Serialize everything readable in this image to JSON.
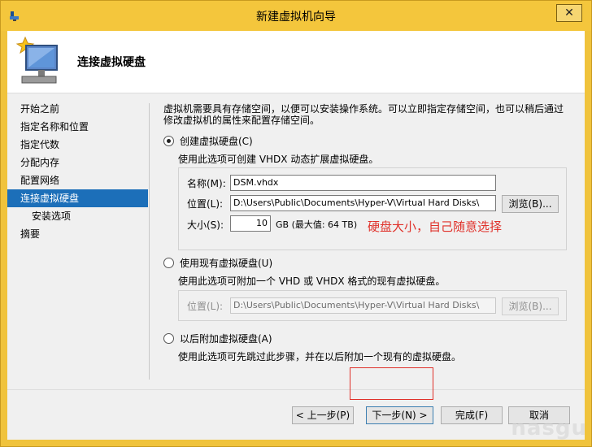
{
  "window": {
    "title": "新建虚拟机向导",
    "close_glyph": "✕"
  },
  "header": {
    "title": "连接虚拟硬盘"
  },
  "nav": {
    "items": [
      {
        "label": "开始之前"
      },
      {
        "label": "指定名称和位置"
      },
      {
        "label": "指定代数"
      },
      {
        "label": "分配内存"
      },
      {
        "label": "配置网络"
      },
      {
        "label": "连接虚拟硬盘"
      },
      {
        "label": "安装选项"
      },
      {
        "label": "摘要"
      }
    ]
  },
  "content": {
    "intro": "虚拟机需要具有存储空间，以便可以安装操作系统。可以立即指定存储空间，也可以稍后通过修改虚拟机的属性来配置存储空间。",
    "create": {
      "label": "创建虚拟硬盘(C)",
      "desc": "使用此选项可创建 VHDX 动态扩展虚拟硬盘。",
      "name_label": "名称(M):",
      "name_value": "DSM.vhdx",
      "location_label": "位置(L):",
      "location_value": "D:\\Users\\Public\\Documents\\Hyper-V\\Virtual Hard Disks\\",
      "browse_label": "浏览(B)...",
      "size_label": "大小(S):",
      "size_value": "10",
      "size_unit": "GB (最大值: 64 TB)",
      "annotation": "硬盘大小，自己随意选择"
    },
    "existing": {
      "label": "使用现有虚拟硬盘(U)",
      "desc": "使用此选项可附加一个 VHD 或 VHDX 格式的现有虚拟硬盘。",
      "location_label": "位置(L):",
      "location_value": "D:\\Users\\Public\\Documents\\Hyper-V\\Virtual Hard Disks\\",
      "browse_label": "浏览(B)..."
    },
    "later": {
      "label": "以后附加虚拟硬盘(A)",
      "desc": "使用此选项可先跳过此步骤，并在以后附加一个现有的虚拟硬盘。"
    }
  },
  "footer": {
    "prev_label": "< 上一步(P)",
    "next_label": "下一步(N) >",
    "finish_label": "完成(F)",
    "cancel_label": "取消"
  },
  "watermark": "nasgu"
}
